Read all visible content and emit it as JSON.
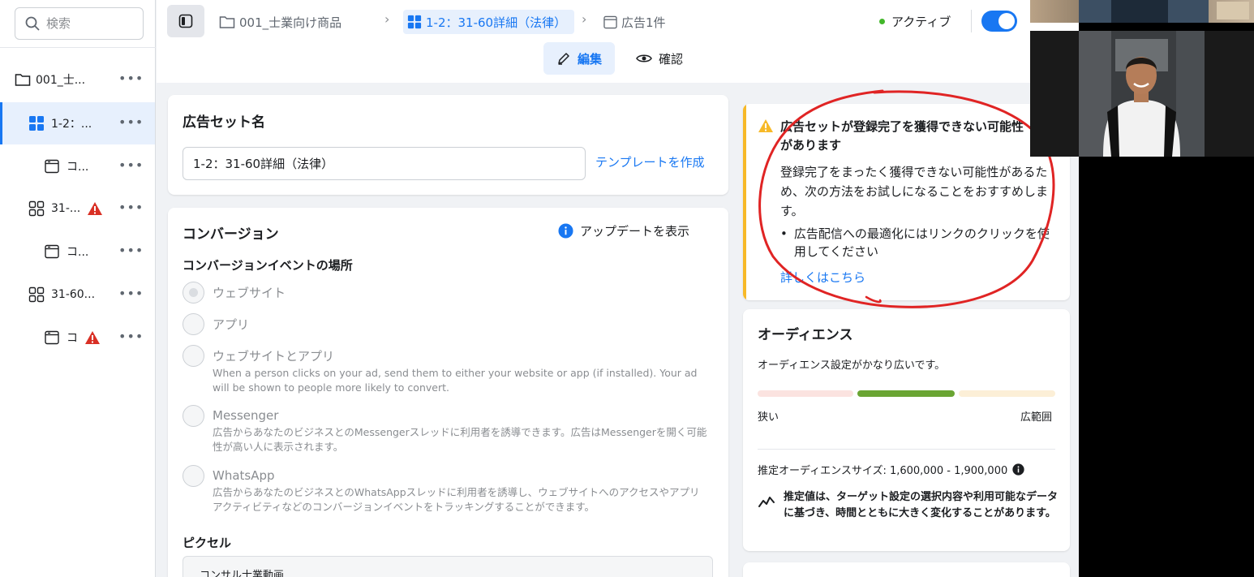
{
  "sidebar": {
    "search_placeholder": "検索",
    "items": [
      {
        "label": "001_士...",
        "icon": "folder-icon"
      },
      {
        "label": "1-2：...",
        "icon": "adset-grid-icon"
      },
      {
        "label": "コ...",
        "icon": "ad-icon"
      },
      {
        "label": "31-...",
        "icon": "adset-grid-icon",
        "warning": true
      },
      {
        "label": "コ...",
        "icon": "ad-icon"
      },
      {
        "label": "31-60...",
        "icon": "adset-grid-icon"
      },
      {
        "label": "コ",
        "icon": "ad-icon",
        "warning": true
      }
    ],
    "more_label": "•••"
  },
  "topbar": {
    "crumb_campaign": "001_士業向け商品",
    "crumb_adset": "1-2：31-60詳細（法律）",
    "crumb_ads": "広告1件",
    "status": "アクティブ",
    "tab_edit": "編集",
    "tab_review": "確認"
  },
  "adset_card": {
    "title": "広告セット名",
    "name_value": "1-2：31-60詳細（法律）",
    "template_link": "テンプレートを作成"
  },
  "conversion_card": {
    "title": "コンバージョン",
    "updates_link": "アップデートを表示",
    "location_label": "コンバージョンイベントの場所",
    "options": [
      {
        "label": "ウェブサイト",
        "desc": ""
      },
      {
        "label": "アプリ",
        "desc": ""
      },
      {
        "label": "ウェブサイトとアプリ",
        "desc": "When a person clicks on your ad, send them to either your website or app (if installed). Your ad will be shown to people more likely to convert."
      },
      {
        "label": "Messenger",
        "desc": "広告からあなたのビジネスとのMessengerスレッドに利用者を誘導できます。広告はMessengerを開く可能性が高い人に表示されます。"
      },
      {
        "label": "WhatsApp",
        "desc": "広告からあなたのビジネスとのWhatsAppスレッドに利用者を誘導し、ウェブサイトへのアクセスやアプリアクティビティなどのコンバージョンイベントをトラッキングすることができます。"
      }
    ],
    "pixel_title": "ピクセル",
    "pixel_value": "コンサル士業動画"
  },
  "warning_card": {
    "title": "広告セットが登録完了を獲得できない可能性があります",
    "body": "登録完了をまったく獲得できない可能性があるため、次の方法をお試しになることをおすすめします。",
    "bullet": "広告配信への最適化にはリンクのクリックを使用してください",
    "link": "詳しくはこちら"
  },
  "audience_card": {
    "title": "オーディエンス",
    "desc": "オーディエンス設定がかなり広いです。",
    "narrow_label": "狭い",
    "broad_label": "広範囲",
    "size_text": "推定オーディエンスサイズ: 1,600,000 - 1,900,000",
    "note": "推定値は、ターゲット設定の選択内容や利用可能なデータに基づき、時間とともに大きく変化することがあります。"
  },
  "colors": {
    "accent": "#1877f2",
    "warning": "#f7b928",
    "danger": "#d93025",
    "success": "#42b72a",
    "meter_active": "#6aa533",
    "annotation": "#e02424"
  }
}
